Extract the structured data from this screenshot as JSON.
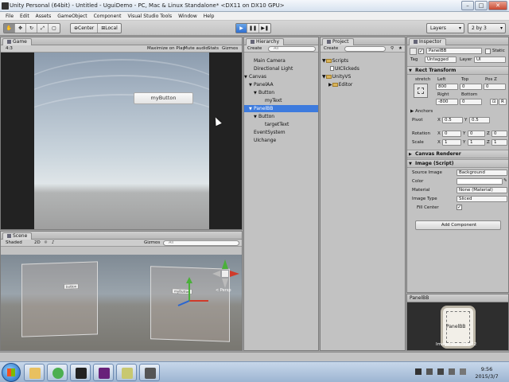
{
  "window": {
    "title": "Unity Personal (64bit) - Untitled - UguiDemo - PC, Mac & Linux Standalone* <DX11 on DX10 GPU>",
    "controls": [
      "–",
      "□",
      "✕"
    ]
  },
  "menu": [
    "File",
    "Edit",
    "Assets",
    "GameObject",
    "Component",
    "Visual Studio Tools",
    "Window",
    "Help"
  ],
  "toolbar": {
    "pivot": "Center",
    "space": "Local",
    "layers": "Layers",
    "layout": "2 by 3",
    "play_glyph": "▶",
    "pause_glyph": "❚❚",
    "step_glyph": "▶❚"
  },
  "game": {
    "tab": "Game",
    "aspect": "4:3",
    "options": [
      "Maximize on Play",
      "Mute audio",
      "Stats",
      "Gizmos"
    ],
    "button_label": "myButton"
  },
  "scene": {
    "tab": "Scene",
    "shading": "Shaded",
    "toggles": [
      "2D",
      "☼",
      "♪"
    ],
    "gizmos": "Gizmos",
    "search": "All",
    "persp": "< Persp",
    "box_labels": [
      "button",
      "myButton"
    ]
  },
  "hierarchy": {
    "tab": "Hierarchy",
    "create": "Create",
    "search": "All",
    "items": [
      {
        "label": "Main Camera",
        "arrow": ""
      },
      {
        "label": "Directional Light",
        "arrow": ""
      },
      {
        "label": "Canvas",
        "arrow": "▼"
      },
      {
        "label": "PanelAA",
        "arrow": "▼"
      },
      {
        "label": "Button",
        "arrow": "▼"
      },
      {
        "label": "myText",
        "arrow": ""
      },
      {
        "label": "PanelBB",
        "arrow": "▼"
      },
      {
        "label": "Button",
        "arrow": "▼"
      },
      {
        "label": "targetText",
        "arrow": ""
      },
      {
        "label": "EventSystem",
        "arrow": ""
      },
      {
        "label": "UIchange",
        "arrow": ""
      }
    ]
  },
  "project": {
    "tab": "Project",
    "create": "Create",
    "items": [
      {
        "label": "Scripts",
        "arrow": "▼",
        "folder": true
      },
      {
        "label": "UIClickeds",
        "arrow": "",
        "folder": false
      },
      {
        "label": "UnityVS",
        "arrow": "▼",
        "folder": true
      },
      {
        "label": "Editor",
        "arrow": "▶",
        "folder": true
      }
    ]
  },
  "inspector": {
    "tab": "Inspector",
    "object_name": "PanelBB",
    "static_label": "Static",
    "tag_label": "Tag",
    "tag_value": "Untagged",
    "layer_label": "Layer",
    "layer_value": "UI",
    "rect_transform": {
      "title": "Rect Transform",
      "anchor_mode": "stretch",
      "col_labels": [
        "Left",
        "Top",
        "Pos Z"
      ],
      "row1": [
        "800",
        "0",
        "0"
      ],
      "col_labels2": [
        "Right",
        "Bottom"
      ],
      "row2": [
        "-800",
        "0"
      ],
      "btn_r": "R",
      "anchors": "Anchors",
      "pivot_label": "Pivot",
      "pivot": {
        "x": "0.5",
        "y": "0.5"
      },
      "rotation_label": "Rotation",
      "rotation": {
        "x": "0",
        "y": "0",
        "z": "0"
      },
      "scale_label": "Scale",
      "scale": {
        "x": "1",
        "y": "1",
        "z": "1"
      }
    },
    "canvas_renderer": "Canvas Renderer",
    "image": {
      "title": "Image (Script)",
      "source_label": "Source Image",
      "source_value": "Background",
      "color_label": "Color",
      "color_value": "#ffffff",
      "material_label": "Material",
      "material_value": "None (Material)",
      "type_label": "Image Type",
      "type_value": "Sliced",
      "fill_label": "Fill Center"
    },
    "add_component": "Add Component"
  },
  "preview": {
    "title": "PanelBB",
    "caption": "Image Size: 32x32",
    "label": "PanelBB"
  },
  "taskbar": {
    "apps": [
      "folder",
      "chrome",
      "unity",
      "visual-studio",
      "notepad",
      "recorder"
    ],
    "tray_time": "9:56",
    "tray_date": "2015/3/7",
    "app_colors": {
      "folder": "#e8c060",
      "chrome": "#4caf50",
      "unity": "#222222",
      "visual-studio": "#68217a",
      "notepad": "#c8c870",
      "recorder": "#555555"
    }
  }
}
